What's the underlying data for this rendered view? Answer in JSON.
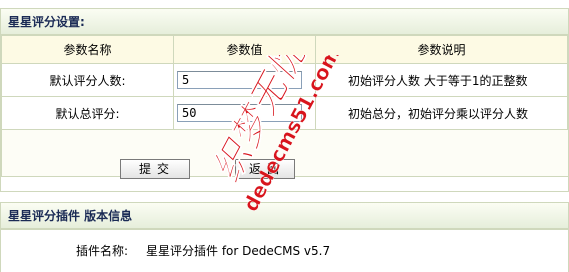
{
  "settings": {
    "title": "星星评分设置:",
    "headers": [
      "参数名称",
      "参数值",
      "参数说明"
    ],
    "rows": [
      {
        "name": "默认评分人数:",
        "value": "5",
        "desc": "初始评分人数 大于等于1的正整数"
      },
      {
        "name": "默认总评分:",
        "value": "50",
        "desc": "初始总分，初始评分乘以评分人数"
      }
    ],
    "submit_label": "提交",
    "back_label": "返回"
  },
  "plugin": {
    "title": "星星评分插件 版本信息",
    "label": "插件名称:",
    "value": "星星评分插件 for DedeCMS v5.7"
  },
  "watermark": {
    "text_red": "织梦无忧",
    "text_url": "dedecms51.com",
    "color": "#d8141c"
  }
}
